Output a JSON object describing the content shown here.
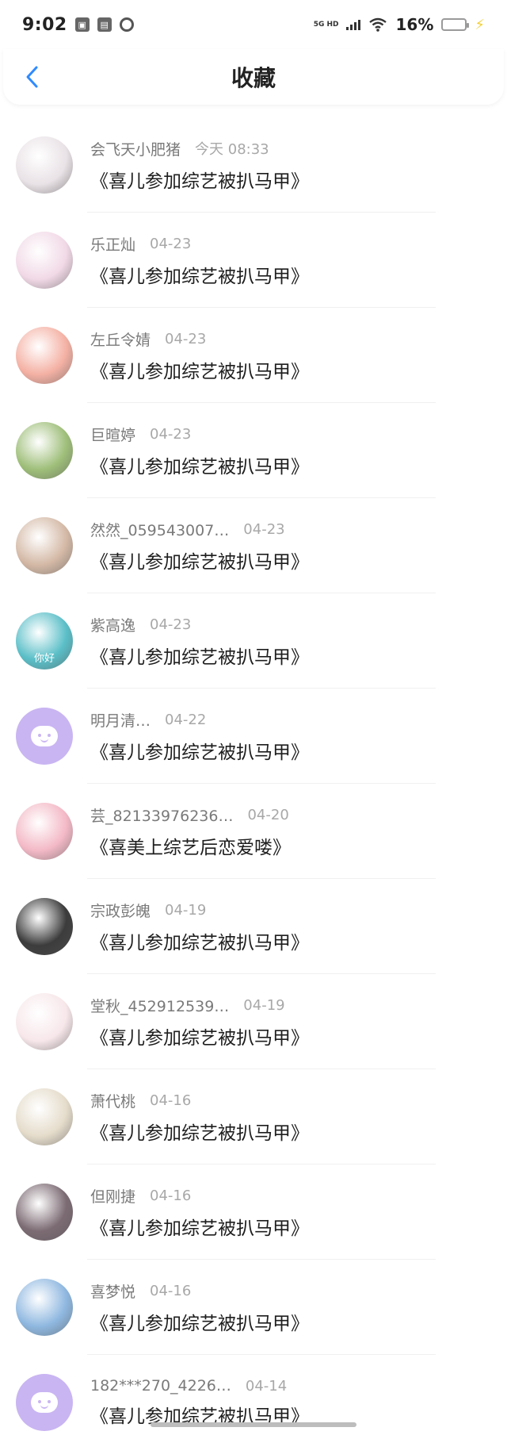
{
  "status_bar": {
    "time": "9:02",
    "network": "5G HD",
    "battery_percent": "16%",
    "battery_level": 0.16,
    "accent_charging": "#f2d13a",
    "battery_fill_color": "#4cd964"
  },
  "header": {
    "title": "收藏",
    "back_icon": "chevron-left-icon",
    "accent_color": "#2f8bff"
  },
  "items": [
    {
      "username": "会飞天小肥猪",
      "date": "今天 08:33",
      "title": "《喜儿参加综艺被扒马甲》",
      "avatar": "photo",
      "avatar_color": "#e9e2e6"
    },
    {
      "username": "乐正灿",
      "date": "04-23",
      "title": "《喜儿参加综艺被扒马甲》",
      "avatar": "photo",
      "avatar_color": "#f1d9e6"
    },
    {
      "username": "左丘令婧",
      "date": "04-23",
      "title": "《喜儿参加综艺被扒马甲》",
      "avatar": "photo",
      "avatar_color": "#f4b1a4"
    },
    {
      "username": "巨暄婷",
      "date": "04-23",
      "title": "《喜儿参加综艺被扒马甲》",
      "avatar": "photo",
      "avatar_color": "#9fbf7a"
    },
    {
      "username": "然然_059543007…",
      "date": "04-23",
      "title": "《喜儿参加综艺被扒马甲》",
      "avatar": "photo",
      "avatar_color": "#d4b9a6"
    },
    {
      "username": "紫高逸",
      "date": "04-23",
      "title": "《喜儿参加综艺被扒马甲》",
      "avatar": "photo",
      "avatar_color": "#5bbfc8",
      "avatar_caption": "你好"
    },
    {
      "username": "明月清…",
      "date": "04-22",
      "title": "《喜儿参加综艺被扒马甲》",
      "avatar": "default",
      "avatar_color": "#c9b5f2"
    },
    {
      "username": "芸_82133976236…",
      "date": "04-20",
      "title": "《喜美上综艺后恋爱喽》",
      "avatar": "photo",
      "avatar_color": "#f3b9c6"
    },
    {
      "username": "宗政彭魄",
      "date": "04-19",
      "title": "《喜儿参加综艺被扒马甲》",
      "avatar": "photo",
      "avatar_color": "#3c3c3c"
    },
    {
      "username": "堂秋_452912539…",
      "date": "04-19",
      "title": "《喜儿参加综艺被扒马甲》",
      "avatar": "photo",
      "avatar_color": "#f7e7ea"
    },
    {
      "username": "萧代桃",
      "date": "04-16",
      "title": "《喜儿参加综艺被扒马甲》",
      "avatar": "photo",
      "avatar_color": "#e5dccb"
    },
    {
      "username": "但刚捷",
      "date": "04-16",
      "title": "《喜儿参加综艺被扒马甲》",
      "avatar": "photo",
      "avatar_color": "#7c6b73"
    },
    {
      "username": "喜梦悦",
      "date": "04-16",
      "title": "《喜儿参加综艺被扒马甲》",
      "avatar": "photo",
      "avatar_color": "#8fb8e0"
    },
    {
      "username": "182***270_4226…",
      "date": "04-14",
      "title": "《喜儿参加综艺被扒马甲》",
      "avatar": "default",
      "avatar_color": "#c9b5f2"
    }
  ]
}
